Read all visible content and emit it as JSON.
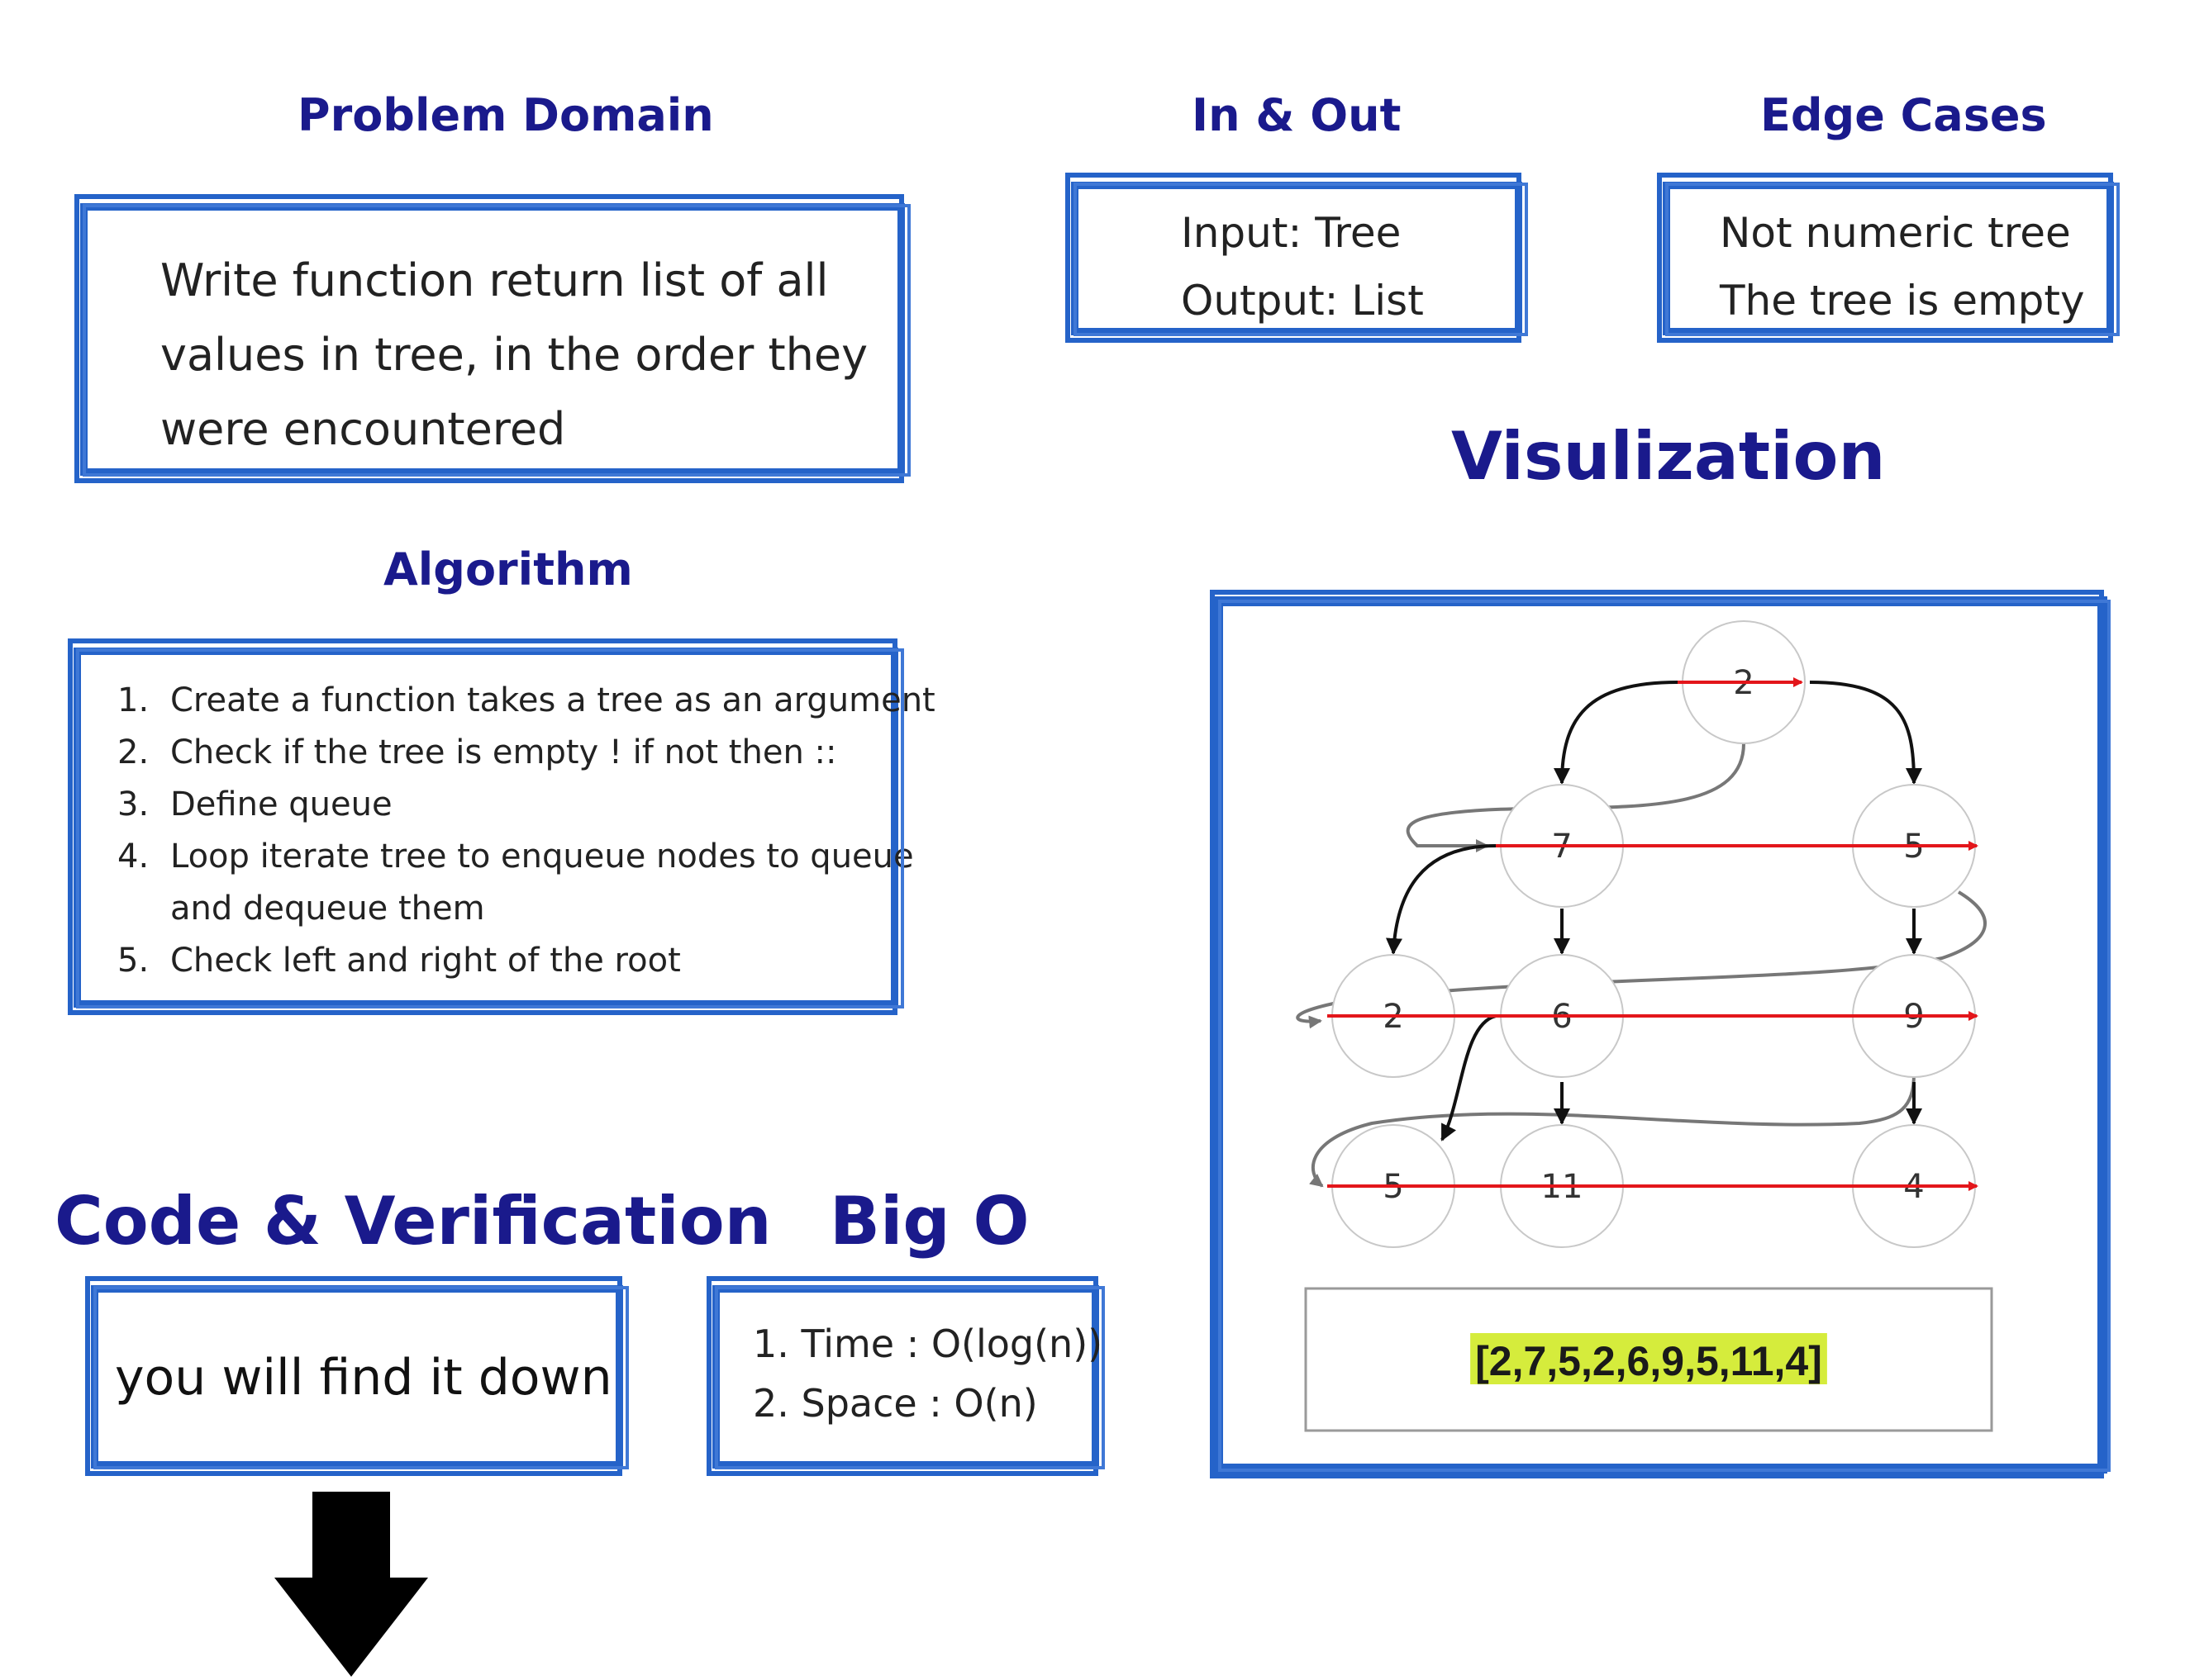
{
  "problem_domain": {
    "title": "Problem Domain",
    "lines": [
      "Write function return list of all",
      "values in tree, in the order they",
      "were encountered"
    ]
  },
  "in_out": {
    "title": "In & Out",
    "input": "Input: Tree",
    "output": "Output: List"
  },
  "edge_cases": {
    "title": "Edge Cases",
    "items": [
      "Not numeric tree",
      "The tree is empty"
    ]
  },
  "algorithm": {
    "title": "Algorithm",
    "steps": [
      {
        "num": "1.",
        "text": "Create a function takes a tree as an argument"
      },
      {
        "num": "2.",
        "text": "Check if the tree is empty ! if not then ::"
      },
      {
        "num": "3.",
        "text": "Define queue"
      },
      {
        "num": "4.",
        "text": "Loop iterate tree to enqueue nodes to queue"
      },
      {
        "num": "",
        "text": "and dequeue them"
      },
      {
        "num": "5.",
        "text": "Check left and right of the root"
      }
    ]
  },
  "visualization": {
    "title": "Visulization",
    "nodes": [
      "2",
      "7",
      "5",
      "2",
      "6",
      "9",
      "5",
      "11",
      "4"
    ],
    "result": "[2,7,5,2,6,9,5,11,4]",
    "colors": {
      "traverse": "#e3161b",
      "tree_edge": "#111111",
      "path": "#777777",
      "highlight": "#d5ec3c",
      "frame": "#2563c9"
    }
  },
  "code_verification": {
    "title": "Code & Verification",
    "text": "you will find it down",
    "icon": "down-arrow-icon"
  },
  "big_o": {
    "title": "Big O",
    "items": [
      "1. Time : O(log(n))",
      "2. Space : O(n)"
    ]
  }
}
